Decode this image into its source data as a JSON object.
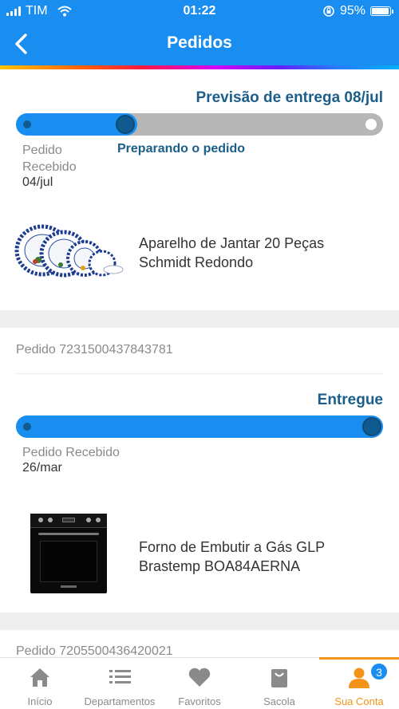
{
  "status_bar": {
    "carrier": "TIM",
    "time": "01:22",
    "battery": "95%",
    "battery_level": 0.95
  },
  "header": {
    "title": "Pedidos",
    "back_icon": "chevron-left-icon"
  },
  "colors": {
    "primary_blue": "#1a8ef0",
    "dark_blue": "#1b5e8a",
    "active_orange": "#f39418"
  },
  "orders": [
    {
      "delivery_estimate": "Previsão de entrega 08/jul",
      "progress": 0.33,
      "steps": {
        "received_label_line1": "Pedido",
        "received_label_line2": "Recebido",
        "received_date": "04/jul",
        "current_label": "Preparando o pedido"
      },
      "product_line1": "Aparelho de Jantar 20 Peças",
      "product_line2": "Schmidt Redondo"
    },
    {
      "order_number": "Pedido 7231500437843781",
      "status": "Entregue",
      "progress": 1.0,
      "steps": {
        "received_label": "Pedido Recebido",
        "received_date": "26/mar"
      },
      "product_line1": "Forno de Embutir a Gás GLP",
      "product_line2": "Brastemp BOA84AERNA"
    },
    {
      "order_number": "Pedido 7205500436420021"
    }
  ],
  "bottom_nav": [
    {
      "label": "Início",
      "icon": "home-icon"
    },
    {
      "label": "Departamentos",
      "icon": "list-icon"
    },
    {
      "label": "Favoritos",
      "icon": "heart-icon"
    },
    {
      "label": "Sacola",
      "icon": "bag-icon"
    },
    {
      "label": "Sua Conta",
      "icon": "user-icon",
      "active": true,
      "badge": "3"
    }
  ]
}
